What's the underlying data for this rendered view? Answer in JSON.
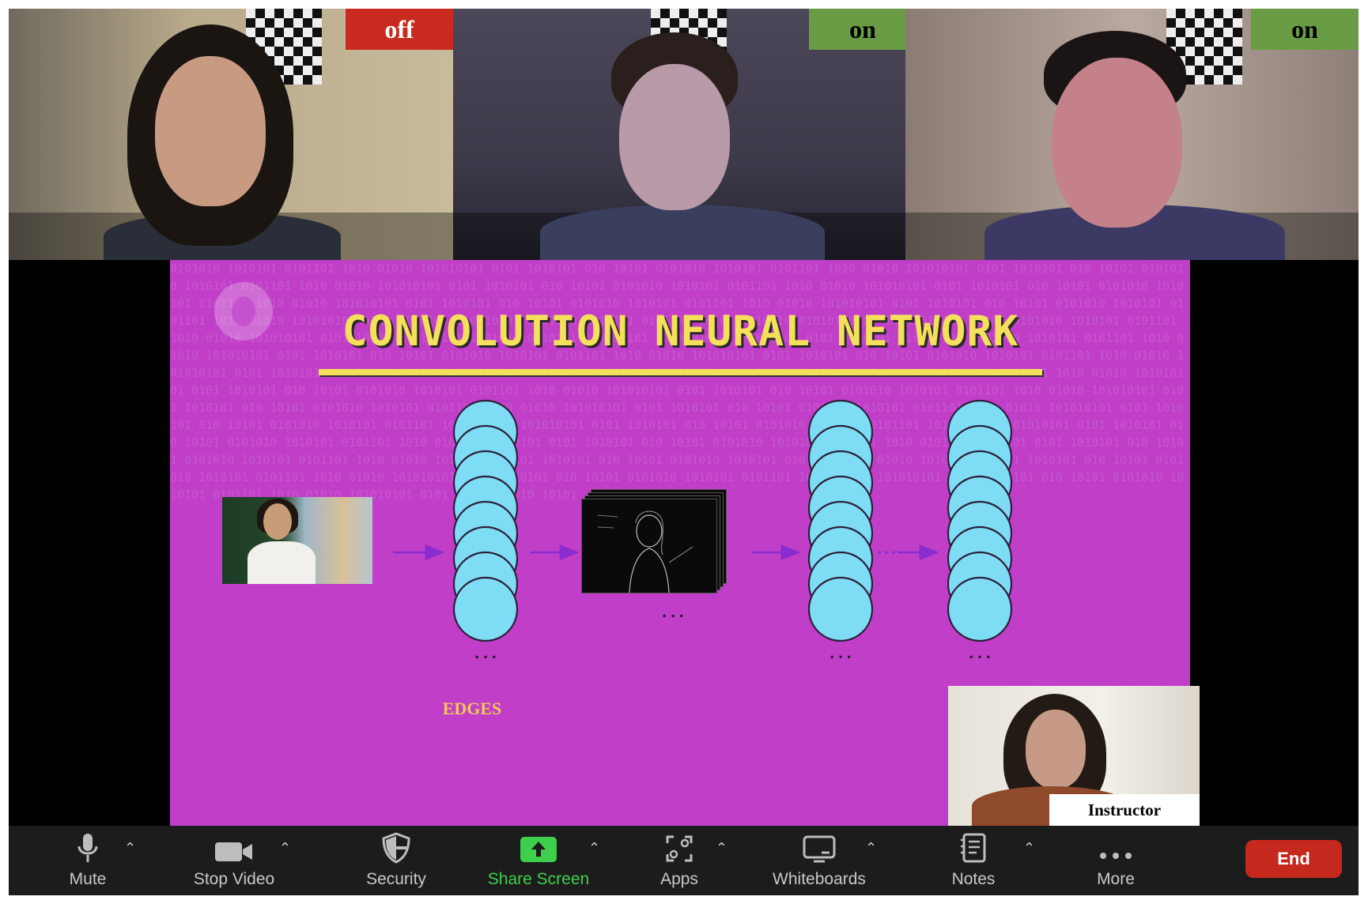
{
  "participants": [
    {
      "status": "off",
      "status_color": "#c92a20"
    },
    {
      "status": "on",
      "status_color": "#6a9c45"
    },
    {
      "status": "on",
      "status_color": "#6a9c45"
    }
  ],
  "slide": {
    "title": "CONVOLUTION NEURAL NETWORK",
    "edges_label": "EDGES",
    "ellipsis": "...",
    "colors": {
      "background": "#c03ec8",
      "title": "#f4e05a",
      "node": "#7fdcf5",
      "arrow": "#8a2ccf"
    }
  },
  "instructor": {
    "label": "Instructor"
  },
  "toolbar": {
    "mute": "Mute",
    "stop_video": "Stop Video",
    "security": "Security",
    "share_screen": "Share Screen",
    "apps": "Apps",
    "whiteboards": "Whiteboards",
    "notes": "Notes",
    "more": "More",
    "end": "End",
    "icons": [
      "microphone-icon",
      "video-camera-icon",
      "shield-icon",
      "share-screen-icon",
      "apps-icon",
      "whiteboard-icon",
      "notes-icon",
      "more-dots-icon"
    ],
    "accent_green": "#3ecf4d",
    "end_color": "#c5281c"
  }
}
